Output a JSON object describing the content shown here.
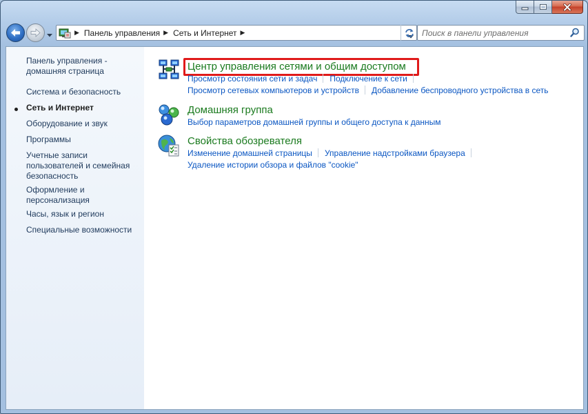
{
  "window": {
    "caption_minimize": "minimize",
    "caption_maximize": "maximize",
    "caption_close": "close"
  },
  "nav": {
    "breadcrumbs": [
      "Панель управления",
      "Сеть и Интернет"
    ],
    "search_placeholder": "Поиск в панели управления"
  },
  "sidebar": {
    "items": [
      {
        "label": "Панель управления - домашняя страница",
        "current": false
      },
      {
        "label": "Система и безопасность",
        "current": false
      },
      {
        "label": "Сеть и Интернет",
        "current": true
      },
      {
        "label": "Оборудование и звук",
        "current": false
      },
      {
        "label": "Программы",
        "current": false
      },
      {
        "label": "Учетные записи пользователей и семейная безопасность",
        "current": false
      },
      {
        "label": "Оформление и персонализация",
        "current": false
      },
      {
        "label": "Часы, язык и регион",
        "current": false
      },
      {
        "label": "Специальные возможности",
        "current": false
      }
    ]
  },
  "sections": [
    {
      "title": "Центр управления сетями и общим доступом",
      "icon": "network-center-icon",
      "links": [
        [
          "Просмотр состояния сети и задач",
          "Подключение к сети"
        ],
        [
          "Просмотр сетевых компьютеров и устройств",
          "Добавление беспроводного устройства в сеть"
        ]
      ]
    },
    {
      "title": "Домашняя группа",
      "icon": "homegroup-icon",
      "links": [
        [
          "Выбор параметров домашней группы и общего доступа к данным"
        ]
      ]
    },
    {
      "title": "Свойства обозревателя",
      "icon": "internet-options-icon",
      "links": [
        [
          "Изменение домашней страницы",
          "Управление надстройками браузера"
        ],
        [
          "Удаление истории обзора и файлов \"cookie\""
        ]
      ]
    }
  ],
  "colors": {
    "link": "#0a56c2",
    "section_title": "#1a7a1e",
    "highlight_box": "#e01a1a"
  }
}
